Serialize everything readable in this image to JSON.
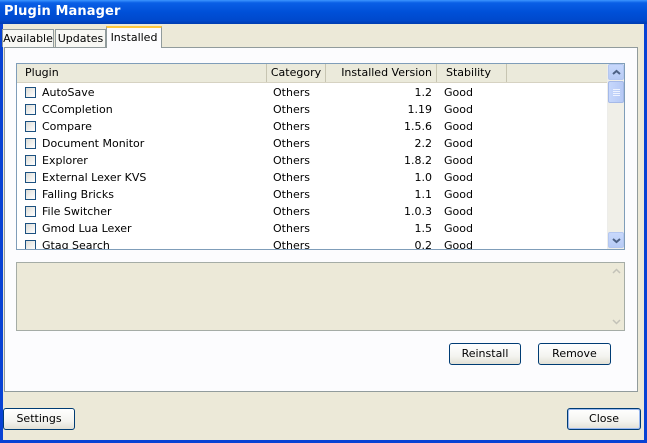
{
  "window": {
    "title": "Plugin Manager"
  },
  "tabs": [
    {
      "label": "Available"
    },
    {
      "label": "Updates"
    },
    {
      "label": "Installed"
    }
  ],
  "table": {
    "columns": [
      "Plugin",
      "Category",
      "Installed Version",
      "Stability"
    ],
    "rows": [
      {
        "name": "AutoSave",
        "category": "Others",
        "version": "1.2",
        "stability": "Good",
        "checked": false
      },
      {
        "name": "CCompletion",
        "category": "Others",
        "version": "1.19",
        "stability": "Good",
        "checked": false
      },
      {
        "name": "Compare",
        "category": "Others",
        "version": "1.5.6",
        "stability": "Good",
        "checked": false
      },
      {
        "name": "Document Monitor",
        "category": "Others",
        "version": "2.2",
        "stability": "Good",
        "checked": false
      },
      {
        "name": "Explorer",
        "category": "Others",
        "version": "1.8.2",
        "stability": "Good",
        "checked": false
      },
      {
        "name": "External Lexer KVS",
        "category": "Others",
        "version": "1.0",
        "stability": "Good",
        "checked": false
      },
      {
        "name": "Falling Bricks",
        "category": "Others",
        "version": "1.1",
        "stability": "Good",
        "checked": false
      },
      {
        "name": "File Switcher",
        "category": "Others",
        "version": "1.0.3",
        "stability": "Good",
        "checked": false
      },
      {
        "name": "Gmod Lua Lexer",
        "category": "Others",
        "version": "1.5",
        "stability": "Good",
        "checked": false
      },
      {
        "name": "Gtag Search",
        "category": "Others",
        "version": "0.2",
        "stability": "Good",
        "checked": false
      }
    ]
  },
  "description": {
    "text": ""
  },
  "buttons": {
    "reinstall": "Reinstall",
    "remove": "Remove",
    "settings": "Settings",
    "close": "Close"
  },
  "colors": {
    "titlebar": "#0050d8",
    "dialog_bg": "#ece9d8",
    "active_tab_accent": "#ffc83c",
    "button_border": "#003c74"
  }
}
